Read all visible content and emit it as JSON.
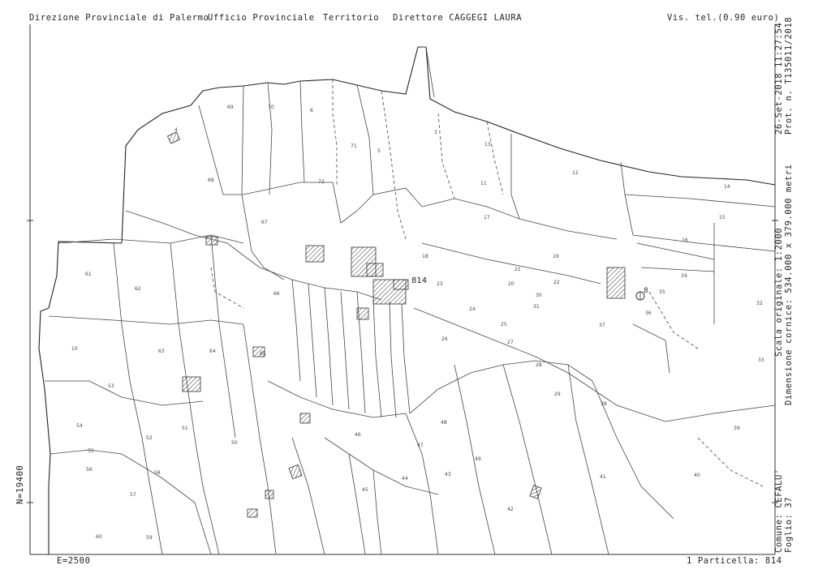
{
  "header": {
    "office": "Direzione Provinciale di Palermo",
    "department": "Ufficio Provinciale",
    "section": "Territorio",
    "director": "Direttore CAGGEGI LAURA",
    "visura": "Vis. tel.(0.90 euro)"
  },
  "right_margin": {
    "date": "26-Set-2018 11:27:54",
    "protocol": "Prot. n. T135011/2018",
    "scale": "Scala originale: 1:2000",
    "dimensions": "Dimensione cornice: 534.000 x 379.000 metri",
    "comune": "Comune: CEFALU'",
    "foglio": "Foglio: 37"
  },
  "left_margin": {
    "north_coordinate": "N=19400"
  },
  "footer": {
    "east_coordinate": "E=2500",
    "particella": "1 Particella: 814"
  },
  "map": {
    "highlight_parcel": "814",
    "marker_parcel": "8",
    "parcel_labels": [
      "4",
      "6",
      "5",
      "3",
      "10",
      "11",
      "12",
      "13",
      "14",
      "15",
      "16",
      "17",
      "18",
      "19",
      "20",
      "21",
      "22",
      "23",
      "24",
      "25",
      "26",
      "27",
      "28",
      "29",
      "30",
      "31",
      "32",
      "33",
      "34",
      "35",
      "36",
      "37",
      "38",
      "39",
      "40",
      "41",
      "42",
      "43",
      "44",
      "45",
      "46",
      "47",
      "48",
      "49",
      "50",
      "51",
      "52",
      "53",
      "54",
      "55",
      "56",
      "57",
      "58",
      "59",
      "60",
      "61",
      "62",
      "63",
      "64",
      "65",
      "66",
      "67",
      "68",
      "69",
      "70",
      "71",
      "72"
    ]
  }
}
